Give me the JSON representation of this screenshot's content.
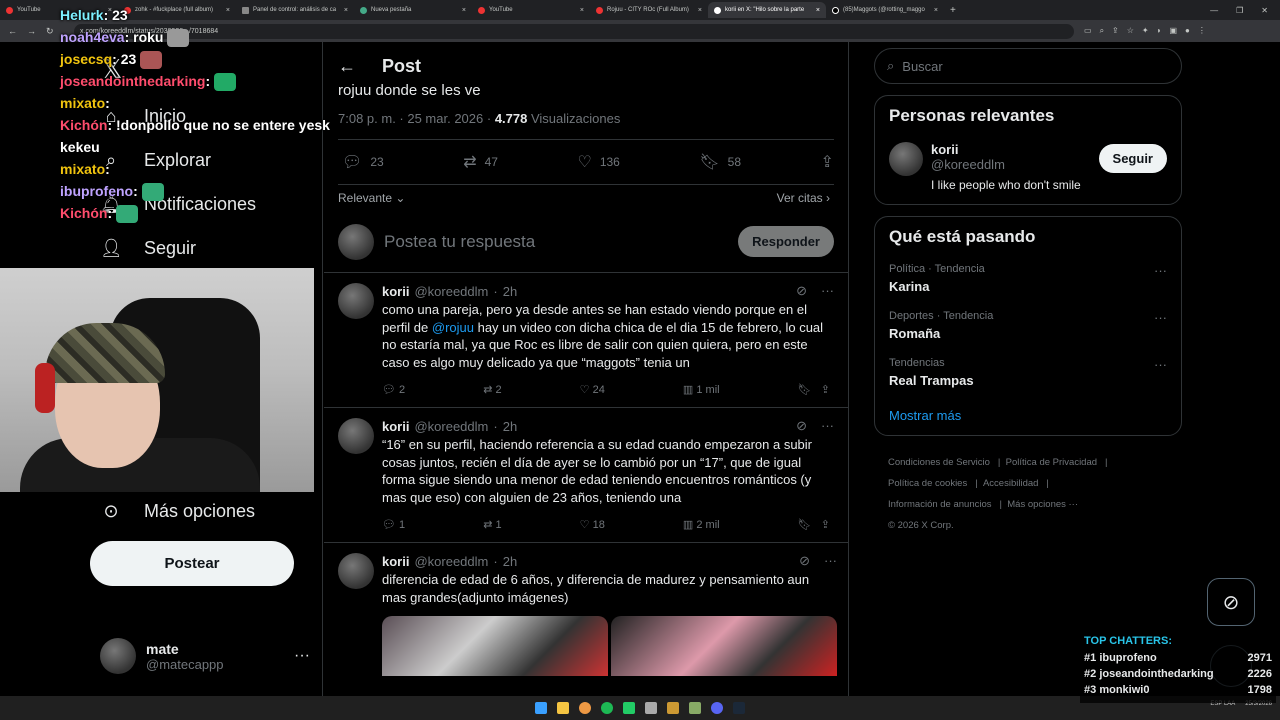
{
  "browser": {
    "tabs": [
      {
        "title": "YouTube",
        "active": false
      },
      {
        "title": "zohk - #fuckplace (full album)",
        "active": false
      },
      {
        "title": "Panel de control: análisis de ca",
        "active": false
      },
      {
        "title": "Nueva pestaña",
        "active": false
      },
      {
        "title": "YouTube",
        "active": false
      },
      {
        "title": "Rojuu - CITY ROc (Full Album)",
        "active": false
      },
      {
        "title": "korii en X: \"Hilo sobre la parte",
        "active": true
      },
      {
        "title": "(85)Maggots (@rotting_maggo",
        "active": false
      }
    ],
    "url": "x.com/koreeddlm/status/2036926.../7018684"
  },
  "stream_chat": [
    {
      "user": "Helurk",
      "text": ": 23",
      "color": "u4"
    },
    {
      "user": "noah4eva",
      "text": ": roku",
      "color": "u1"
    },
    {
      "user": "josecsq",
      "text": ": 23",
      "color": "u3"
    },
    {
      "user": "joseandointhedarking",
      "text": ":",
      "color": "u2"
    },
    {
      "user": "mixato",
      "text": ":",
      "color": "u3"
    },
    {
      "user": "Kichón",
      "text": ": !donpollo que no se entere yesk",
      "color": "u2"
    },
    {
      "user": "",
      "text": "kekeu",
      "color": "u1"
    },
    {
      "user": "mixato",
      "text": ":",
      "color": "u3"
    },
    {
      "user": "ibuprofeno",
      "text": ":",
      "color": "u1"
    },
    {
      "user": "Kichón",
      "text": ":",
      "color": "u2"
    }
  ],
  "leftnav": {
    "items": [
      {
        "label": "Inicio",
        "icon": "home-icon"
      },
      {
        "label": "Explorar",
        "icon": "search-icon"
      },
      {
        "label": "Notificaciones",
        "icon": "bell-icon"
      },
      {
        "label": "Seguir",
        "icon": "add-user-icon"
      }
    ],
    "more_label": "Más opciones",
    "post_label": "Postear",
    "account": {
      "name": "mate",
      "handle": "@matecappp"
    }
  },
  "post": {
    "header_title": "Post",
    "tail_text": "rojuu donde se les ve",
    "time": "7:08 p. m. · 25 mar. 2026 · ",
    "views_count": "4.778",
    "views_label": " Visualizaciones",
    "replies": "23",
    "reposts": "47",
    "likes": "136",
    "bookmarks": "58",
    "sort_label": "Relevante",
    "quotes_label": "Ver citas",
    "reply_placeholder": "Postea tu respuesta",
    "reply_button": "Responder"
  },
  "replies": [
    {
      "name": "korii",
      "handle": "@koreeddlm",
      "time": "2h",
      "text_before": "como una pareja, pero ya desde antes se han estado viendo porque en el perfil de ",
      "mention": "@rojuu",
      "text_after": " hay un video con dicha chica de el dia 15 de febrero, lo cual no estaría mal, ya que Roc es libre de salir con quien quiera, pero en este caso es algo muy delicado ya que “maggots” tenia un",
      "replies": "2",
      "reposts": "2",
      "likes": "24",
      "views": "1 mil"
    },
    {
      "name": "korii",
      "handle": "@koreeddlm",
      "time": "2h",
      "text_before": "“16” en su perfil, haciendo referencia a su edad cuando empezaron a subir cosas juntos, recién el día de ayer se lo cambió por un “17”, que de igual forma sigue siendo una menor de edad teniendo encuentros románticos (y mas que eso) con alguien de 23 años, teniendo una",
      "mention": "",
      "text_after": "",
      "replies": "1",
      "reposts": "1",
      "likes": "18",
      "views": "2 mil"
    },
    {
      "name": "korii",
      "handle": "@koreeddlm",
      "time": "2h",
      "text_before": "diferencia de edad de 6 años, y diferencia de madurez y pensamiento aun mas grandes(adjunto imágenes)",
      "mention": "",
      "text_after": ""
    }
  ],
  "right": {
    "search_placeholder": "Buscar",
    "relevant_title": "Personas relevantes",
    "person": {
      "name": "korii",
      "handle": "@koreeddlm",
      "bio": "I like people who don't smile",
      "follow": "Seguir"
    },
    "trends_title": "Qué está pasando",
    "trends": [
      {
        "category": "Política · Tendencia",
        "title": "Karina"
      },
      {
        "category": "Deportes · Tendencia",
        "title": "Romaña"
      },
      {
        "category": "Tendencias",
        "title": "Real Trampas"
      }
    ],
    "show_more": "Mostrar más",
    "footer": [
      "Condiciones de Servicio",
      "Política de Privacidad",
      "Política de cookies",
      "Accesibilidad",
      "Información de anuncios",
      "Más opciones ···",
      "© 2026 X Corp."
    ]
  },
  "top_chatters": {
    "title": "TOP CHATTERS:",
    "rows": [
      {
        "rank": "#1",
        "name": "ibuprofeno",
        "count": "2971"
      },
      {
        "rank": "#2",
        "name": "joseandointhedarking",
        "count": "2226"
      },
      {
        "rank": "#3",
        "name": "monkiwi0",
        "count": "1798"
      }
    ]
  },
  "taskbar": {
    "lang": "ESP LAA",
    "date": "25/3/2026"
  },
  "colors": {
    "accent": "#1d9bf0",
    "background": "#000000",
    "border": "#2f3336"
  }
}
